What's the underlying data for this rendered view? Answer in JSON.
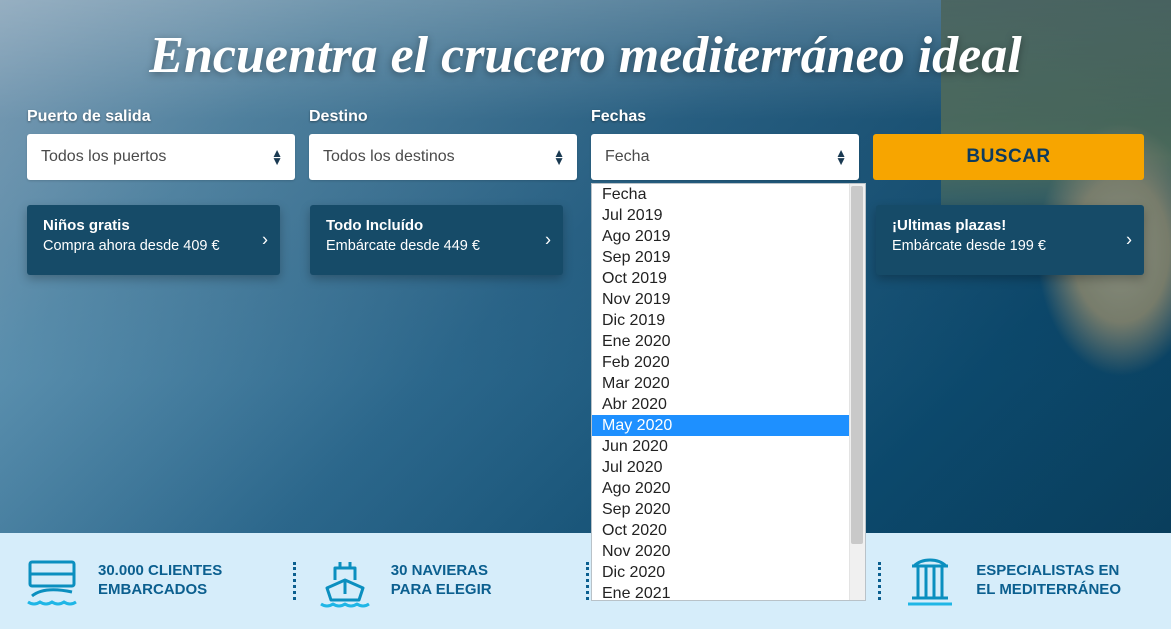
{
  "colors": {
    "accent": "#f7a500",
    "primary": "#0b5f8f",
    "card": "#164b68"
  },
  "hero_title": "Encuentra el crucero mediterráneo ideal",
  "search": {
    "labels": {
      "port": "Puerto de salida",
      "dest": "Destino",
      "dates": "Fechas"
    },
    "port_value": "Todos los puertos",
    "dest_value": "Todos los destinos",
    "date_value": "Fecha",
    "button": "BUSCAR"
  },
  "date_options": [
    "Fecha",
    "Jul 2019",
    "Ago 2019",
    "Sep 2019",
    "Oct 2019",
    "Nov 2019",
    "Dic 2019",
    "Ene 2020",
    "Feb 2020",
    "Mar 2020",
    "Abr 2020",
    "May 2020",
    "Jun 2020",
    "Jul 2020",
    "Ago 2020",
    "Sep 2020",
    "Oct 2020",
    "Nov 2020",
    "Dic 2020",
    "Ene 2021"
  ],
  "date_highlight_index": 11,
  "promos": [
    {
      "title": "Niños gratis",
      "subtitle": "Compra ahora desde 409 €"
    },
    {
      "title": "Todo Incluído",
      "subtitle": "Embárcate desde 449 €"
    },
    {
      "title": "¡Ultimas plazas!",
      "subtitle": "Embárcate desde 199 €"
    }
  ],
  "features": [
    {
      "line1": "30.000 CLIENTES",
      "line2": "EMBARCADOS"
    },
    {
      "line1": "30 NAVIERAS",
      "line2": "PARA ELEGIR"
    },
    {
      "line1": "",
      "line2": ""
    },
    {
      "line1": "ESPECIALISTAS EN",
      "line2": "EL MEDITERRÁNEO"
    }
  ]
}
